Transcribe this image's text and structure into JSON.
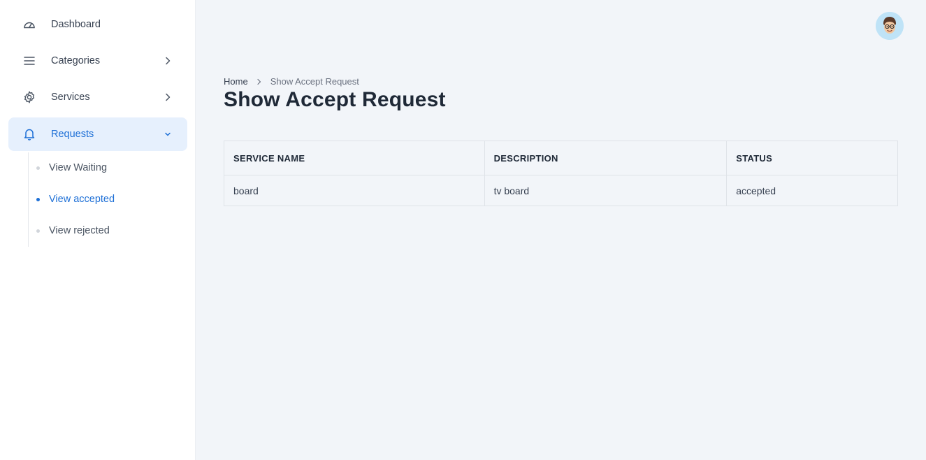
{
  "sidebar": {
    "items": [
      {
        "label": "Dashboard",
        "icon": "dashboard-gauge-icon"
      },
      {
        "label": "Categories",
        "icon": "list-icon"
      },
      {
        "label": "Services",
        "icon": "gear-icon"
      },
      {
        "label": "Requests",
        "icon": "bell-icon"
      }
    ],
    "submenu": [
      {
        "label": "View Waiting"
      },
      {
        "label": "View accepted"
      },
      {
        "label": "View rejected"
      }
    ]
  },
  "header": {
    "avatar_icon": "user-avatar-icon"
  },
  "breadcrumb": {
    "home": "Home",
    "current": "Show Accept Request"
  },
  "page": {
    "title": "Show Accept Request"
  },
  "table": {
    "headers": [
      "SERVICE NAME",
      "DESCRIPTION",
      "STATUS"
    ],
    "rows": [
      {
        "service_name": "board",
        "description": "tv board",
        "status": "accepted"
      }
    ]
  },
  "colors": {
    "accent": "#1d6fd6",
    "active_bg": "#e6f0fd",
    "page_bg": "#f2f5f9"
  }
}
